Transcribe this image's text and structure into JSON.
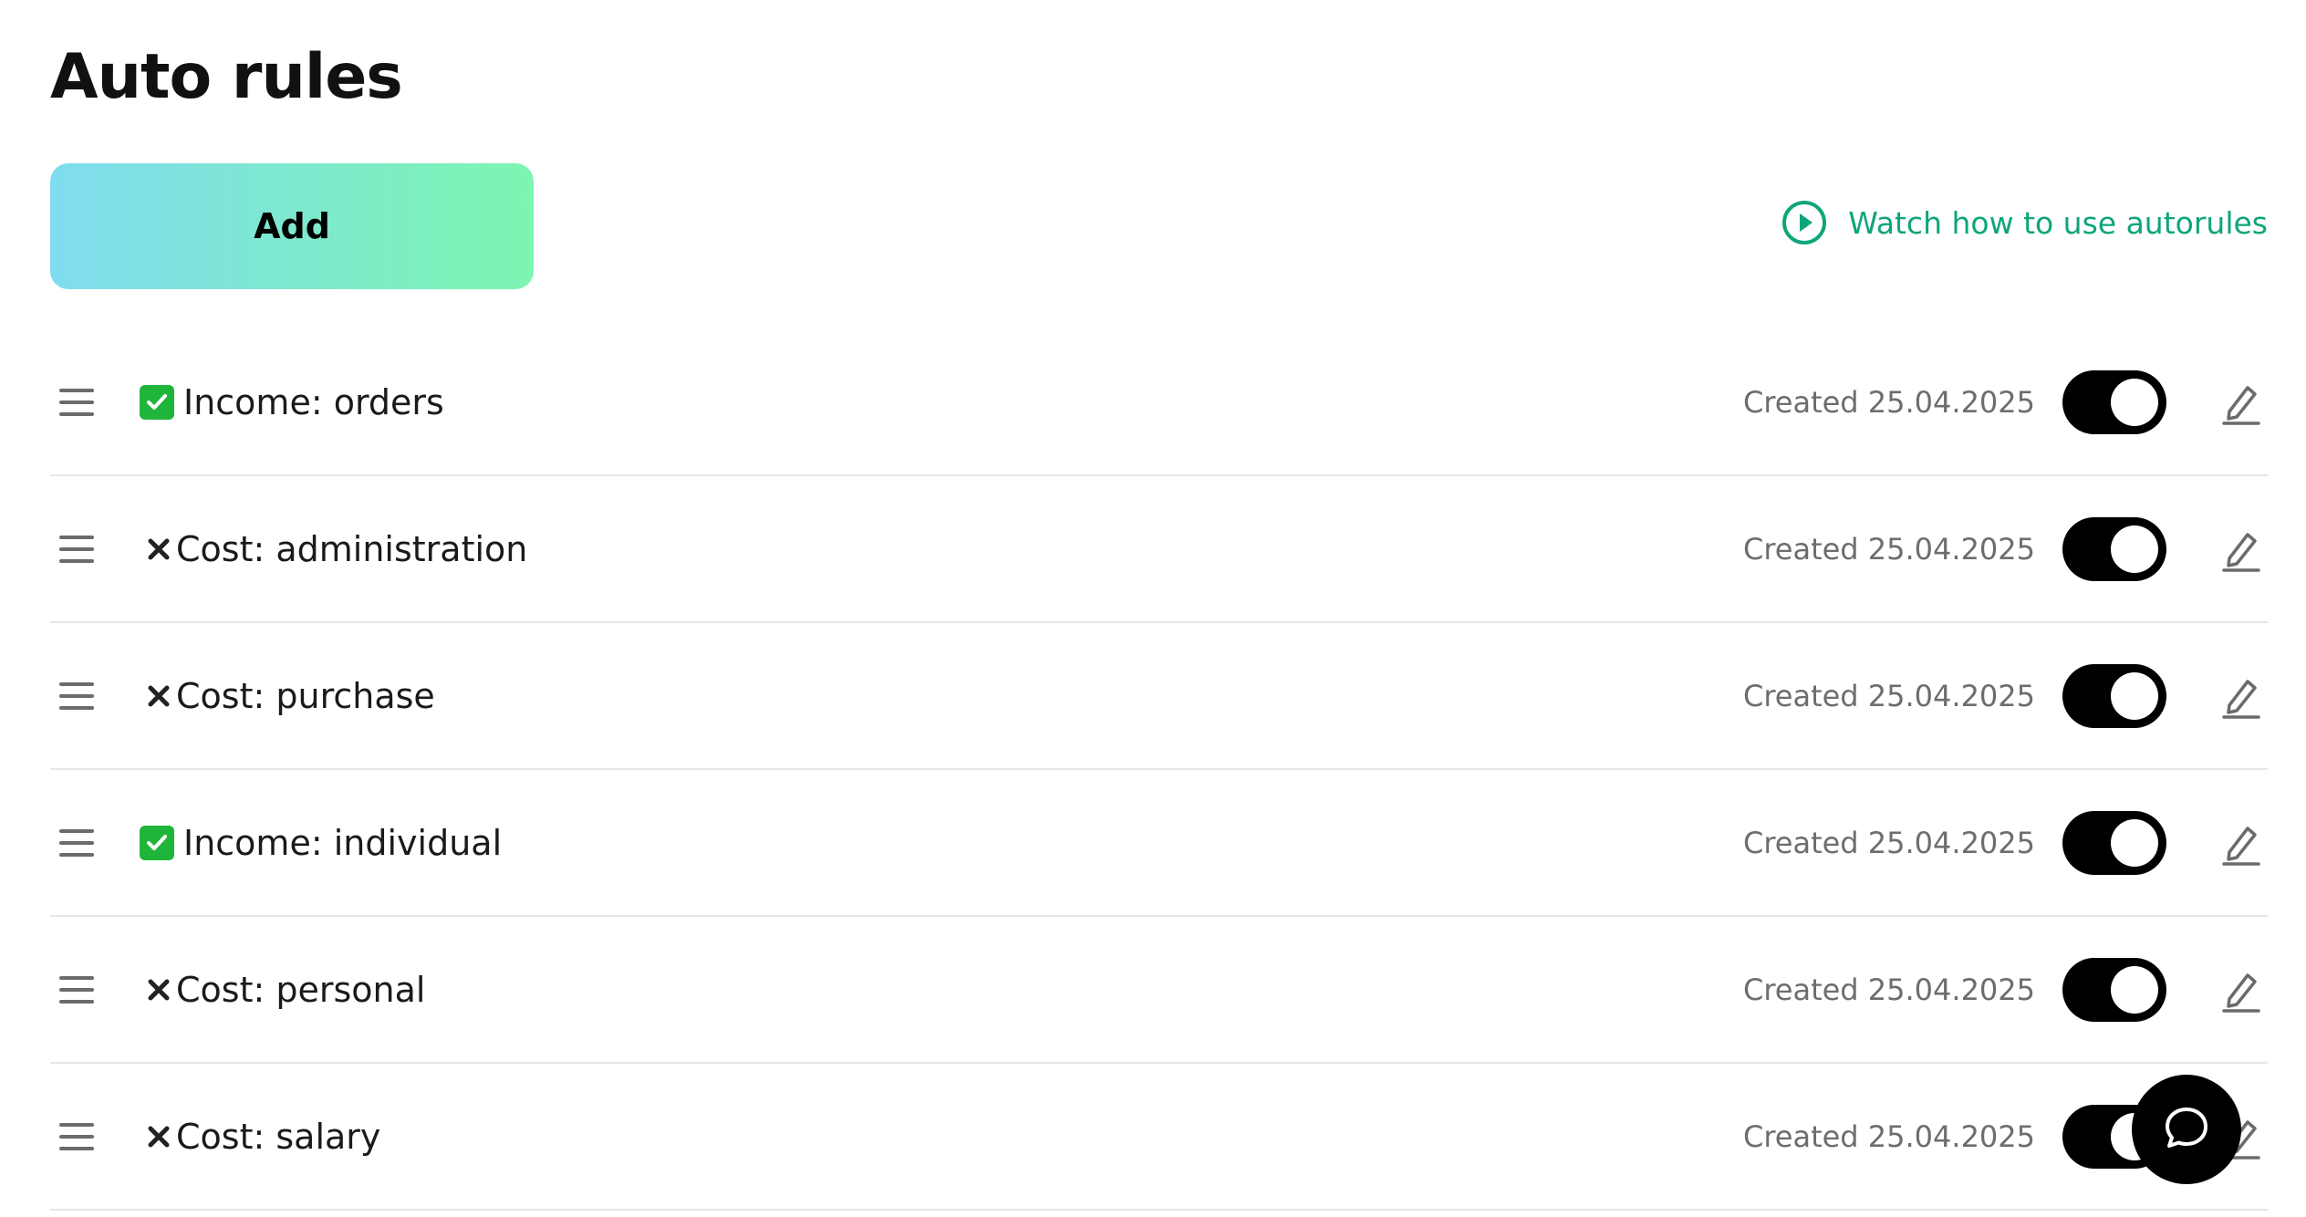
{
  "page": {
    "title": "Auto rules"
  },
  "toolbar": {
    "add_label": "Add",
    "watch_label": "Watch how to use autorules"
  },
  "colors": {
    "accent_green": "#0ea57a",
    "add_gradient_start": "#7fdcef",
    "add_gradient_end": "#7ef5b0",
    "toggle_on": "#000000"
  },
  "rules": [
    {
      "status": "check",
      "status_icon": "green-check-icon",
      "name": "Income: orders",
      "created": "Created 25.04.2025",
      "enabled": true
    },
    {
      "status": "cross",
      "status_icon": "cross-icon",
      "name": "Cost: administration",
      "created": "Created 25.04.2025",
      "enabled": true
    },
    {
      "status": "cross",
      "status_icon": "cross-icon",
      "name": "Cost: purchase",
      "created": "Created 25.04.2025",
      "enabled": true
    },
    {
      "status": "check",
      "status_icon": "green-check-icon",
      "name": "Income: individual",
      "created": "Created 25.04.2025",
      "enabled": true
    },
    {
      "status": "cross",
      "status_icon": "cross-icon",
      "name": "Cost: personal",
      "created": "Created 25.04.2025",
      "enabled": true
    },
    {
      "status": "cross",
      "status_icon": "cross-icon",
      "name": "Cost: salary",
      "created": "Created 25.04.2025",
      "enabled": true
    }
  ],
  "chat": {
    "icon": "chat-bubble-icon"
  }
}
